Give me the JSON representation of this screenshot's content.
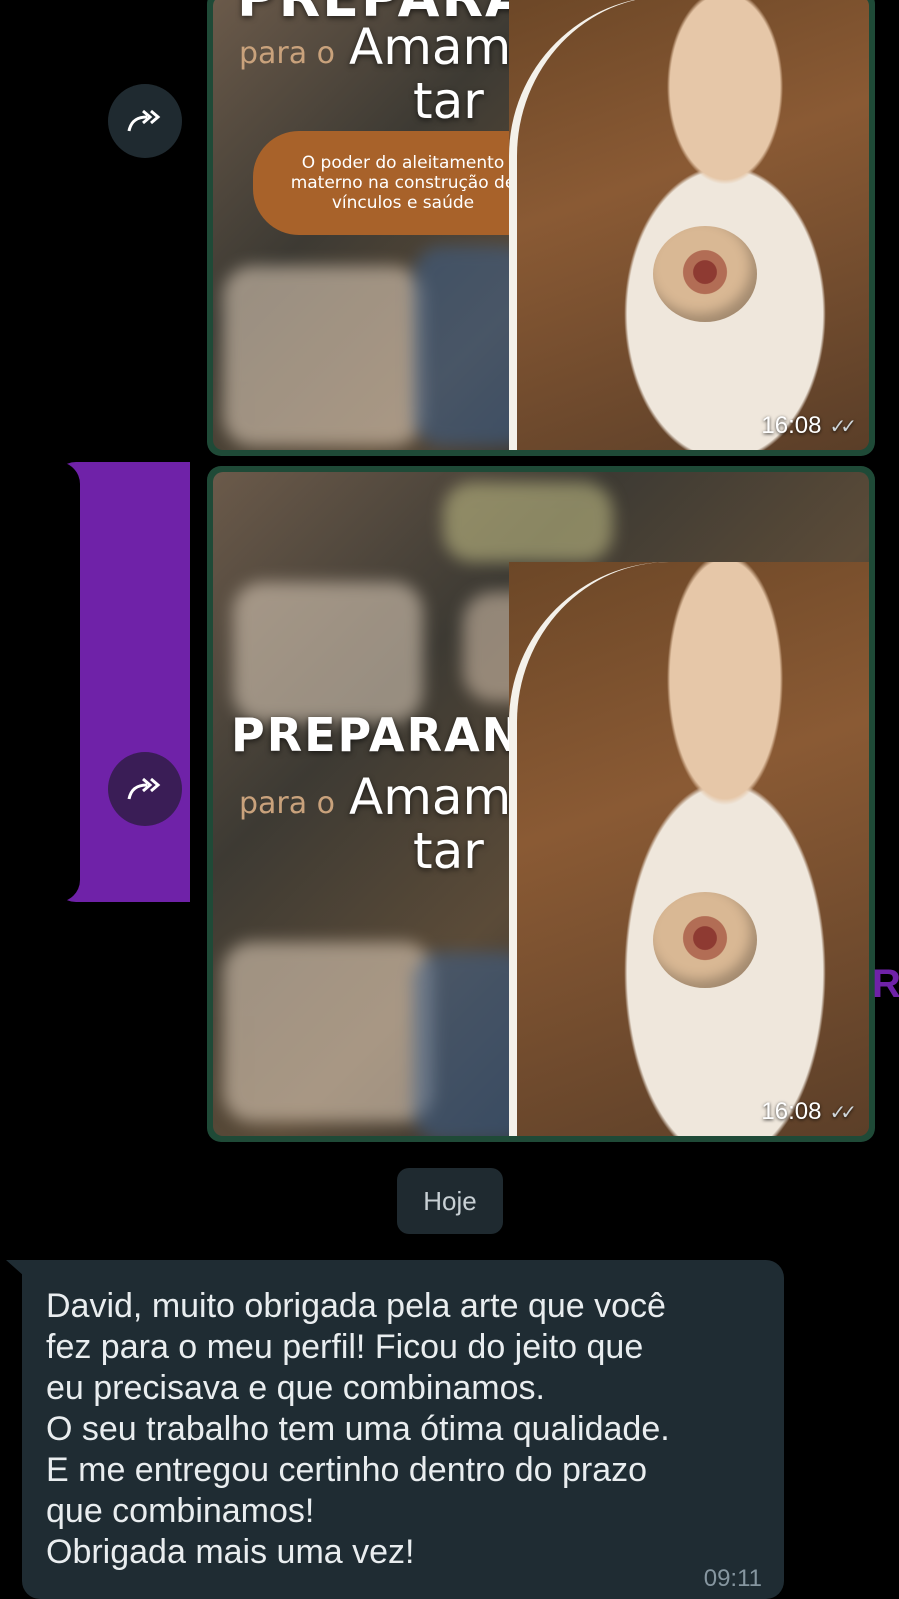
{
  "chat": {
    "images": [
      {
        "title_word": "PREPARANDO",
        "para_o": "para o",
        "amamen": "Amamen",
        "tar": "tar",
        "pill_text": "O poder do aleitamento materno na construção de vínculos e saúde",
        "time": "16:08"
      },
      {
        "title_word": "PREPARANDO",
        "para_o": "para o",
        "amamen": "Amamen",
        "tar": "tar",
        "time": "16:08"
      }
    ],
    "date_divider": "Hoje",
    "message": {
      "lines": [
        "David, muito obrigada pela arte que você",
        "fez para o meu perfil! Ficou do jeito que",
        "eu precisava e que combinamos.",
        "O seu trabalho tem uma ótima qualidade.",
        "E me entregou certinho dentro do prazo",
        "que combinamos!",
        "Obrigada mais uma vez!"
      ],
      "time": "09:11"
    },
    "edge_fragment": "R"
  },
  "colors": {
    "background": "#000000",
    "bubble_incoming": "#1f2c33",
    "image_border": "#1f4a37",
    "selection_purple": "#6f22a8",
    "pill_brown": "#a8622a"
  },
  "icons": [
    "forward-icon",
    "double-check-icon"
  ]
}
